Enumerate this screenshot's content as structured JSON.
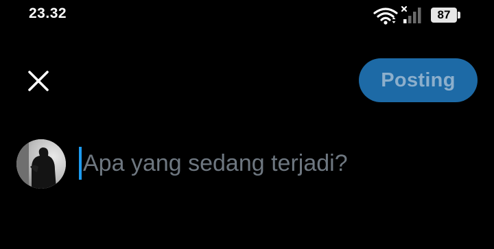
{
  "status_bar": {
    "time": "23.32",
    "battery_level": "87",
    "icons": [
      "wifi-icon",
      "signal-icon",
      "battery-icon"
    ]
  },
  "composer": {
    "close_icon": "close-icon",
    "post_label": "Posting",
    "post_enabled": false,
    "input_value": "",
    "placeholder": "Apa yang sedang terjadi?",
    "avatar_icon": "avatar"
  },
  "colors": {
    "background": "#000000",
    "accent": "#1d9bf0",
    "post_button_disabled": "#1d6aa6",
    "post_label_disabled": "#8cafcc",
    "placeholder": "#6e7780"
  }
}
